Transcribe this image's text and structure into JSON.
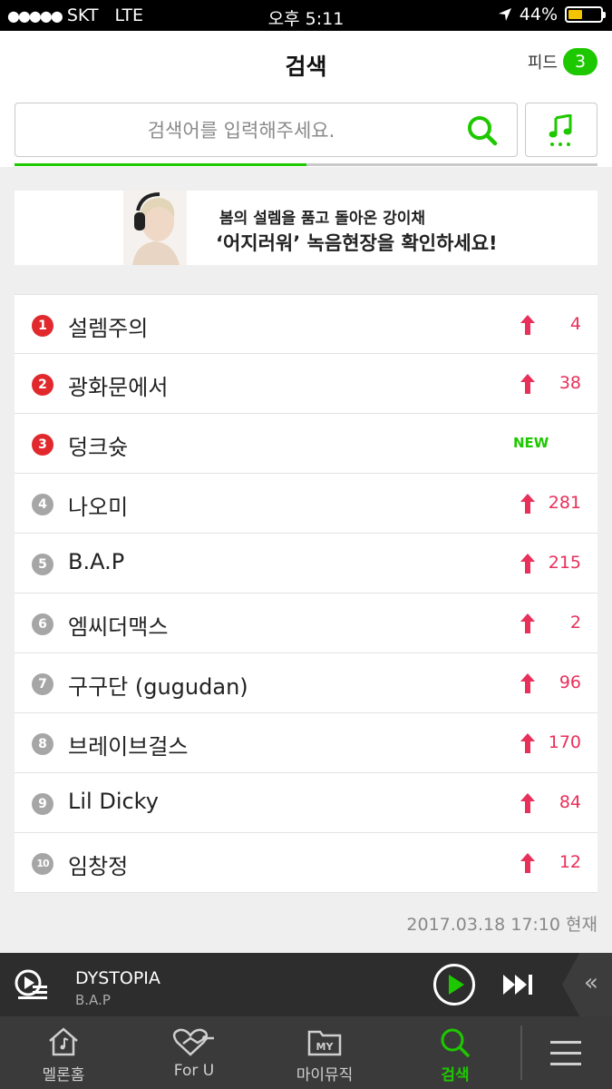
{
  "status_bar": {
    "carrier": "SKT",
    "network": "LTE",
    "time": "오후 5:11",
    "battery": "44%"
  },
  "header": {
    "title": "검색",
    "feed_label": "피드",
    "feed_count": "3"
  },
  "search": {
    "placeholder": "검색어를 입력해주세요.",
    "value": ""
  },
  "banner": {
    "line1": "봄의 설렘을 품고 돌아온 강이채",
    "line2": "‘어지러워’ 녹음현장을 확인하세요!"
  },
  "ranking": [
    {
      "rank": "1",
      "keyword": "설렘주의",
      "change": "4",
      "status": "up"
    },
    {
      "rank": "2",
      "keyword": "광화문에서",
      "change": "38",
      "status": "up"
    },
    {
      "rank": "3",
      "keyword": "덩크슛",
      "change": "NEW",
      "status": "new"
    },
    {
      "rank": "4",
      "keyword": "나오미",
      "change": "281",
      "status": "up"
    },
    {
      "rank": "5",
      "keyword": "B.A.P",
      "change": "215",
      "status": "up"
    },
    {
      "rank": "6",
      "keyword": "엠씨더맥스",
      "change": "2",
      "status": "up"
    },
    {
      "rank": "7",
      "keyword": "구구단 (gugudan)",
      "change": "96",
      "status": "up"
    },
    {
      "rank": "8",
      "keyword": "브레이브걸스",
      "change": "170",
      "status": "up"
    },
    {
      "rank": "9",
      "keyword": "Lil Dicky",
      "change": "84",
      "status": "up"
    },
    {
      "rank": "10",
      "keyword": "임창정",
      "change": "12",
      "status": "up"
    }
  ],
  "timestamp": "2017.03.18 17:10 현재",
  "player": {
    "song": "DYSTOPIA",
    "artist": "B.A.P"
  },
  "tabs": [
    {
      "label": "멜론홈",
      "icon": "home-icon"
    },
    {
      "label": "For U",
      "icon": "heart-icon"
    },
    {
      "label": "마이뮤직",
      "icon": "my-folder-icon"
    },
    {
      "label": "검색",
      "icon": "search-icon"
    }
  ],
  "colors": {
    "accent": "#1ec800",
    "rank_top": "#e0282d",
    "rank_rest": "#a6a6a6",
    "rise": "#e8305a"
  }
}
